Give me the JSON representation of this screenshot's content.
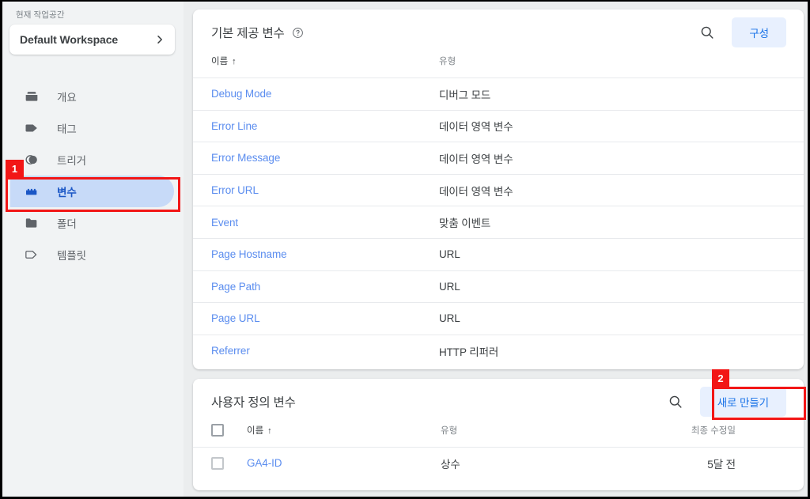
{
  "sidebar": {
    "workspace_label": "현재 작업공간",
    "workspace_name": "Default Workspace",
    "chevron_icon": "chevron-right-icon",
    "items": [
      {
        "label": "개요",
        "icon": "overview-icon",
        "active": false
      },
      {
        "label": "태그",
        "icon": "tag-icon",
        "active": false
      },
      {
        "label": "트리거",
        "icon": "trigger-icon",
        "active": false
      },
      {
        "label": "변수",
        "icon": "variable-icon",
        "active": true
      },
      {
        "label": "폴더",
        "icon": "folder-icon",
        "active": false
      },
      {
        "label": "템플릿",
        "icon": "template-icon",
        "active": false
      }
    ]
  },
  "builtin_panel": {
    "title": "기본 제공 변수",
    "help_icon": "help-circle-icon",
    "search_icon": "search-icon",
    "configure_label": "구성",
    "columns": {
      "name": "이름",
      "type": "유형"
    },
    "sort_arrow": "↑",
    "rows": [
      {
        "name": "Debug Mode",
        "type": "디버그 모드"
      },
      {
        "name": "Error Line",
        "type": "데이터 영역 변수"
      },
      {
        "name": "Error Message",
        "type": "데이터 영역 변수"
      },
      {
        "name": "Error URL",
        "type": "데이터 영역 변수"
      },
      {
        "name": "Event",
        "type": "맞춤 이벤트"
      },
      {
        "name": "Page Hostname",
        "type": "URL"
      },
      {
        "name": "Page Path",
        "type": "URL"
      },
      {
        "name": "Page URL",
        "type": "URL"
      },
      {
        "name": "Referrer",
        "type": "HTTP 리퍼러"
      }
    ]
  },
  "user_panel": {
    "title": "사용자 정의 변수",
    "search_icon": "search-icon",
    "new_label": "새로 만들기",
    "columns": {
      "name": "이름",
      "type": "유형",
      "modified": "최종 수정일"
    },
    "sort_arrow": "↑",
    "rows": [
      {
        "name": "GA4-ID",
        "type": "상수",
        "modified": "5달 전"
      }
    ]
  },
  "annotations": [
    {
      "badge": "1",
      "target": "sidebar-item-variables"
    },
    {
      "badge": "2",
      "target": "new-variable-button"
    }
  ],
  "colors": {
    "accent_blue": "#1a73e8",
    "link_blue": "#5b8def",
    "pill_bg": "#e8f0fe",
    "active_nav_bg": "#c7daf8",
    "annotation_red": "#f21616",
    "sidebar_bg": "#f1f3f4",
    "content_bg": "#ebedee"
  }
}
